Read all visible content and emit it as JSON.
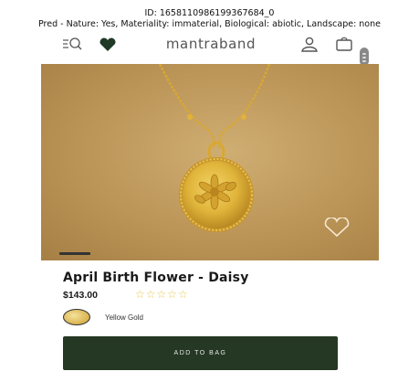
{
  "caption": {
    "id_line": "ID: 1658110986199367684_0",
    "pred_line": "Pred - Nature: Yes, Materiality: immaterial, Biological: abiotic, Landscape: none"
  },
  "header": {
    "brand": "mantraband",
    "icons": [
      "search-icon",
      "heart-icon",
      "user-icon",
      "bag-icon"
    ]
  },
  "product": {
    "title": "April Birth Flower - Daisy",
    "price": "$143.00",
    "rating": {
      "stars_filled": 0,
      "stars_total": 5,
      "display": "☆☆☆☆☆"
    },
    "variant_label": "Yellow Gold",
    "add_to_bag_label": "ADD TO BAG"
  },
  "colors": {
    "button_bg": "#253824",
    "accent_heart": "#1f3a26",
    "star": "#e9c64a",
    "gold": "#d9b24e"
  }
}
